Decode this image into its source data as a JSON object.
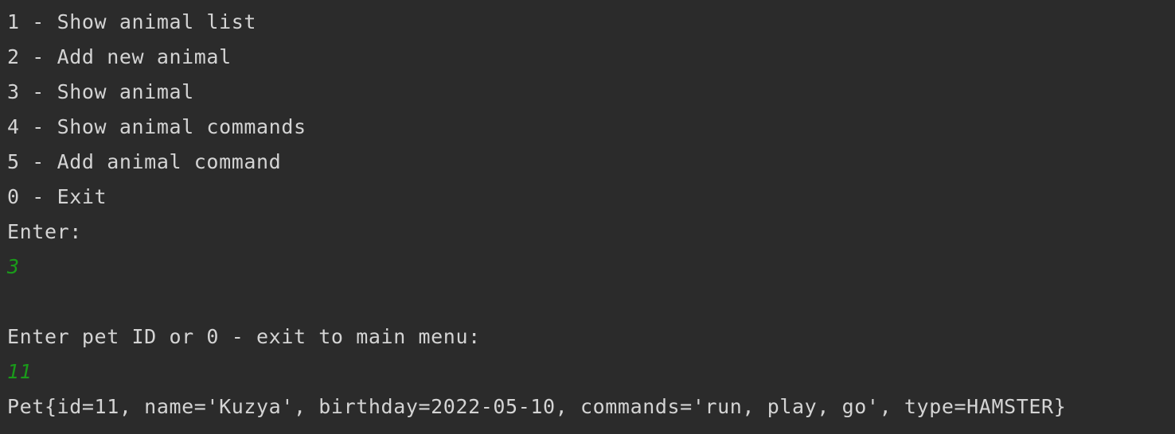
{
  "console": {
    "lines": [
      {
        "text": "1 - Show animal list",
        "kind": "output"
      },
      {
        "text": "2 - Add new animal",
        "kind": "output"
      },
      {
        "text": "3 - Show animal",
        "kind": "output"
      },
      {
        "text": "4 - Show animal commands",
        "kind": "output"
      },
      {
        "text": "5 - Add animal command",
        "kind": "output"
      },
      {
        "text": "0 - Exit",
        "kind": "output"
      },
      {
        "text": "Enter:",
        "kind": "output"
      },
      {
        "text": "3",
        "kind": "input"
      },
      {
        "text": "",
        "kind": "blank"
      },
      {
        "text": "Enter pet ID or 0 - exit to main menu:",
        "kind": "output"
      },
      {
        "text": "11",
        "kind": "input"
      },
      {
        "text": "Pet{id=11, name='Kuzya', birthday=2022-05-10, commands='run, play, go', type=HAMSTER}",
        "kind": "output"
      }
    ]
  },
  "colors": {
    "background": "#2b2b2b",
    "output_text": "#d4d4d4",
    "user_input_text": "#1a9a1a"
  }
}
